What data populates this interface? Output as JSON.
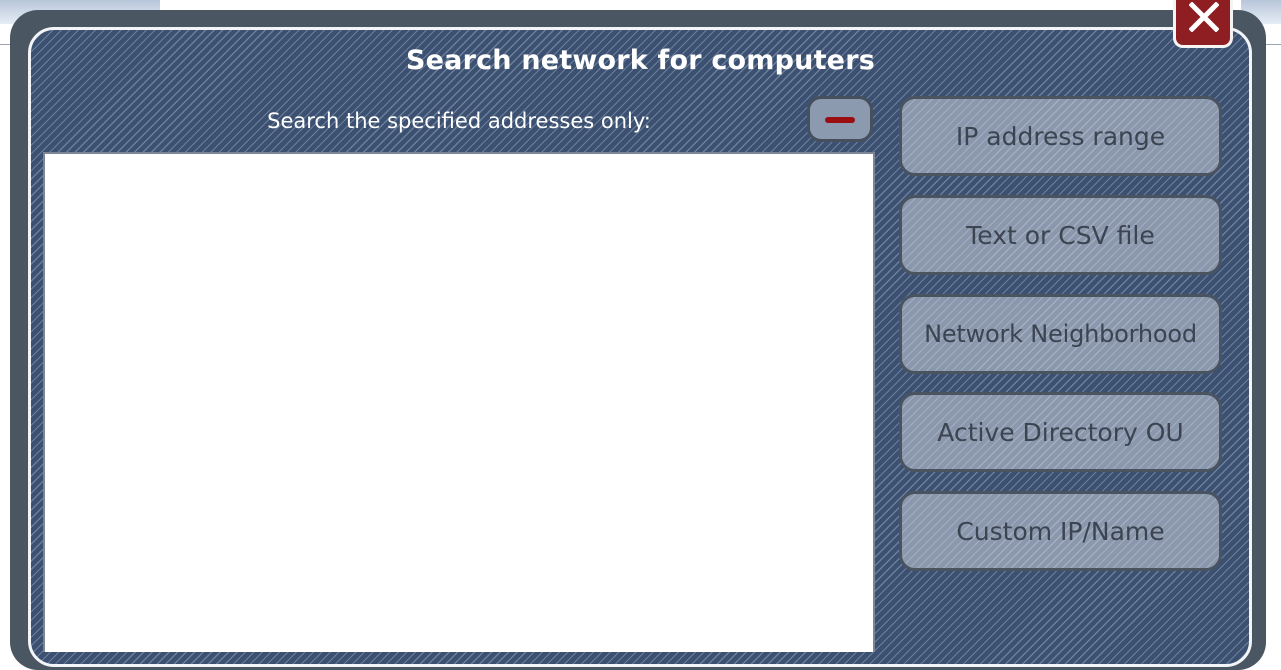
{
  "dialog": {
    "title": "Search network for computers",
    "list_label": "Search the specified addresses only:",
    "address_list": [],
    "buttons": {
      "ip_range": "IP address range",
      "text_csv": "Text or CSV file",
      "network_neighborhood": "Network Neighborhood",
      "active_directory_ou": "Active Directory OU",
      "custom_ip_name": "Custom IP/Name"
    },
    "icons": {
      "close": "close-icon",
      "remove": "minus-icon"
    },
    "colors": {
      "panel_background": "#3c5171",
      "close_button": "#8e1e22",
      "remove_bar": "#9a0e12",
      "side_button": "#8e9bb0",
      "side_button_text": "#3b4450"
    }
  }
}
